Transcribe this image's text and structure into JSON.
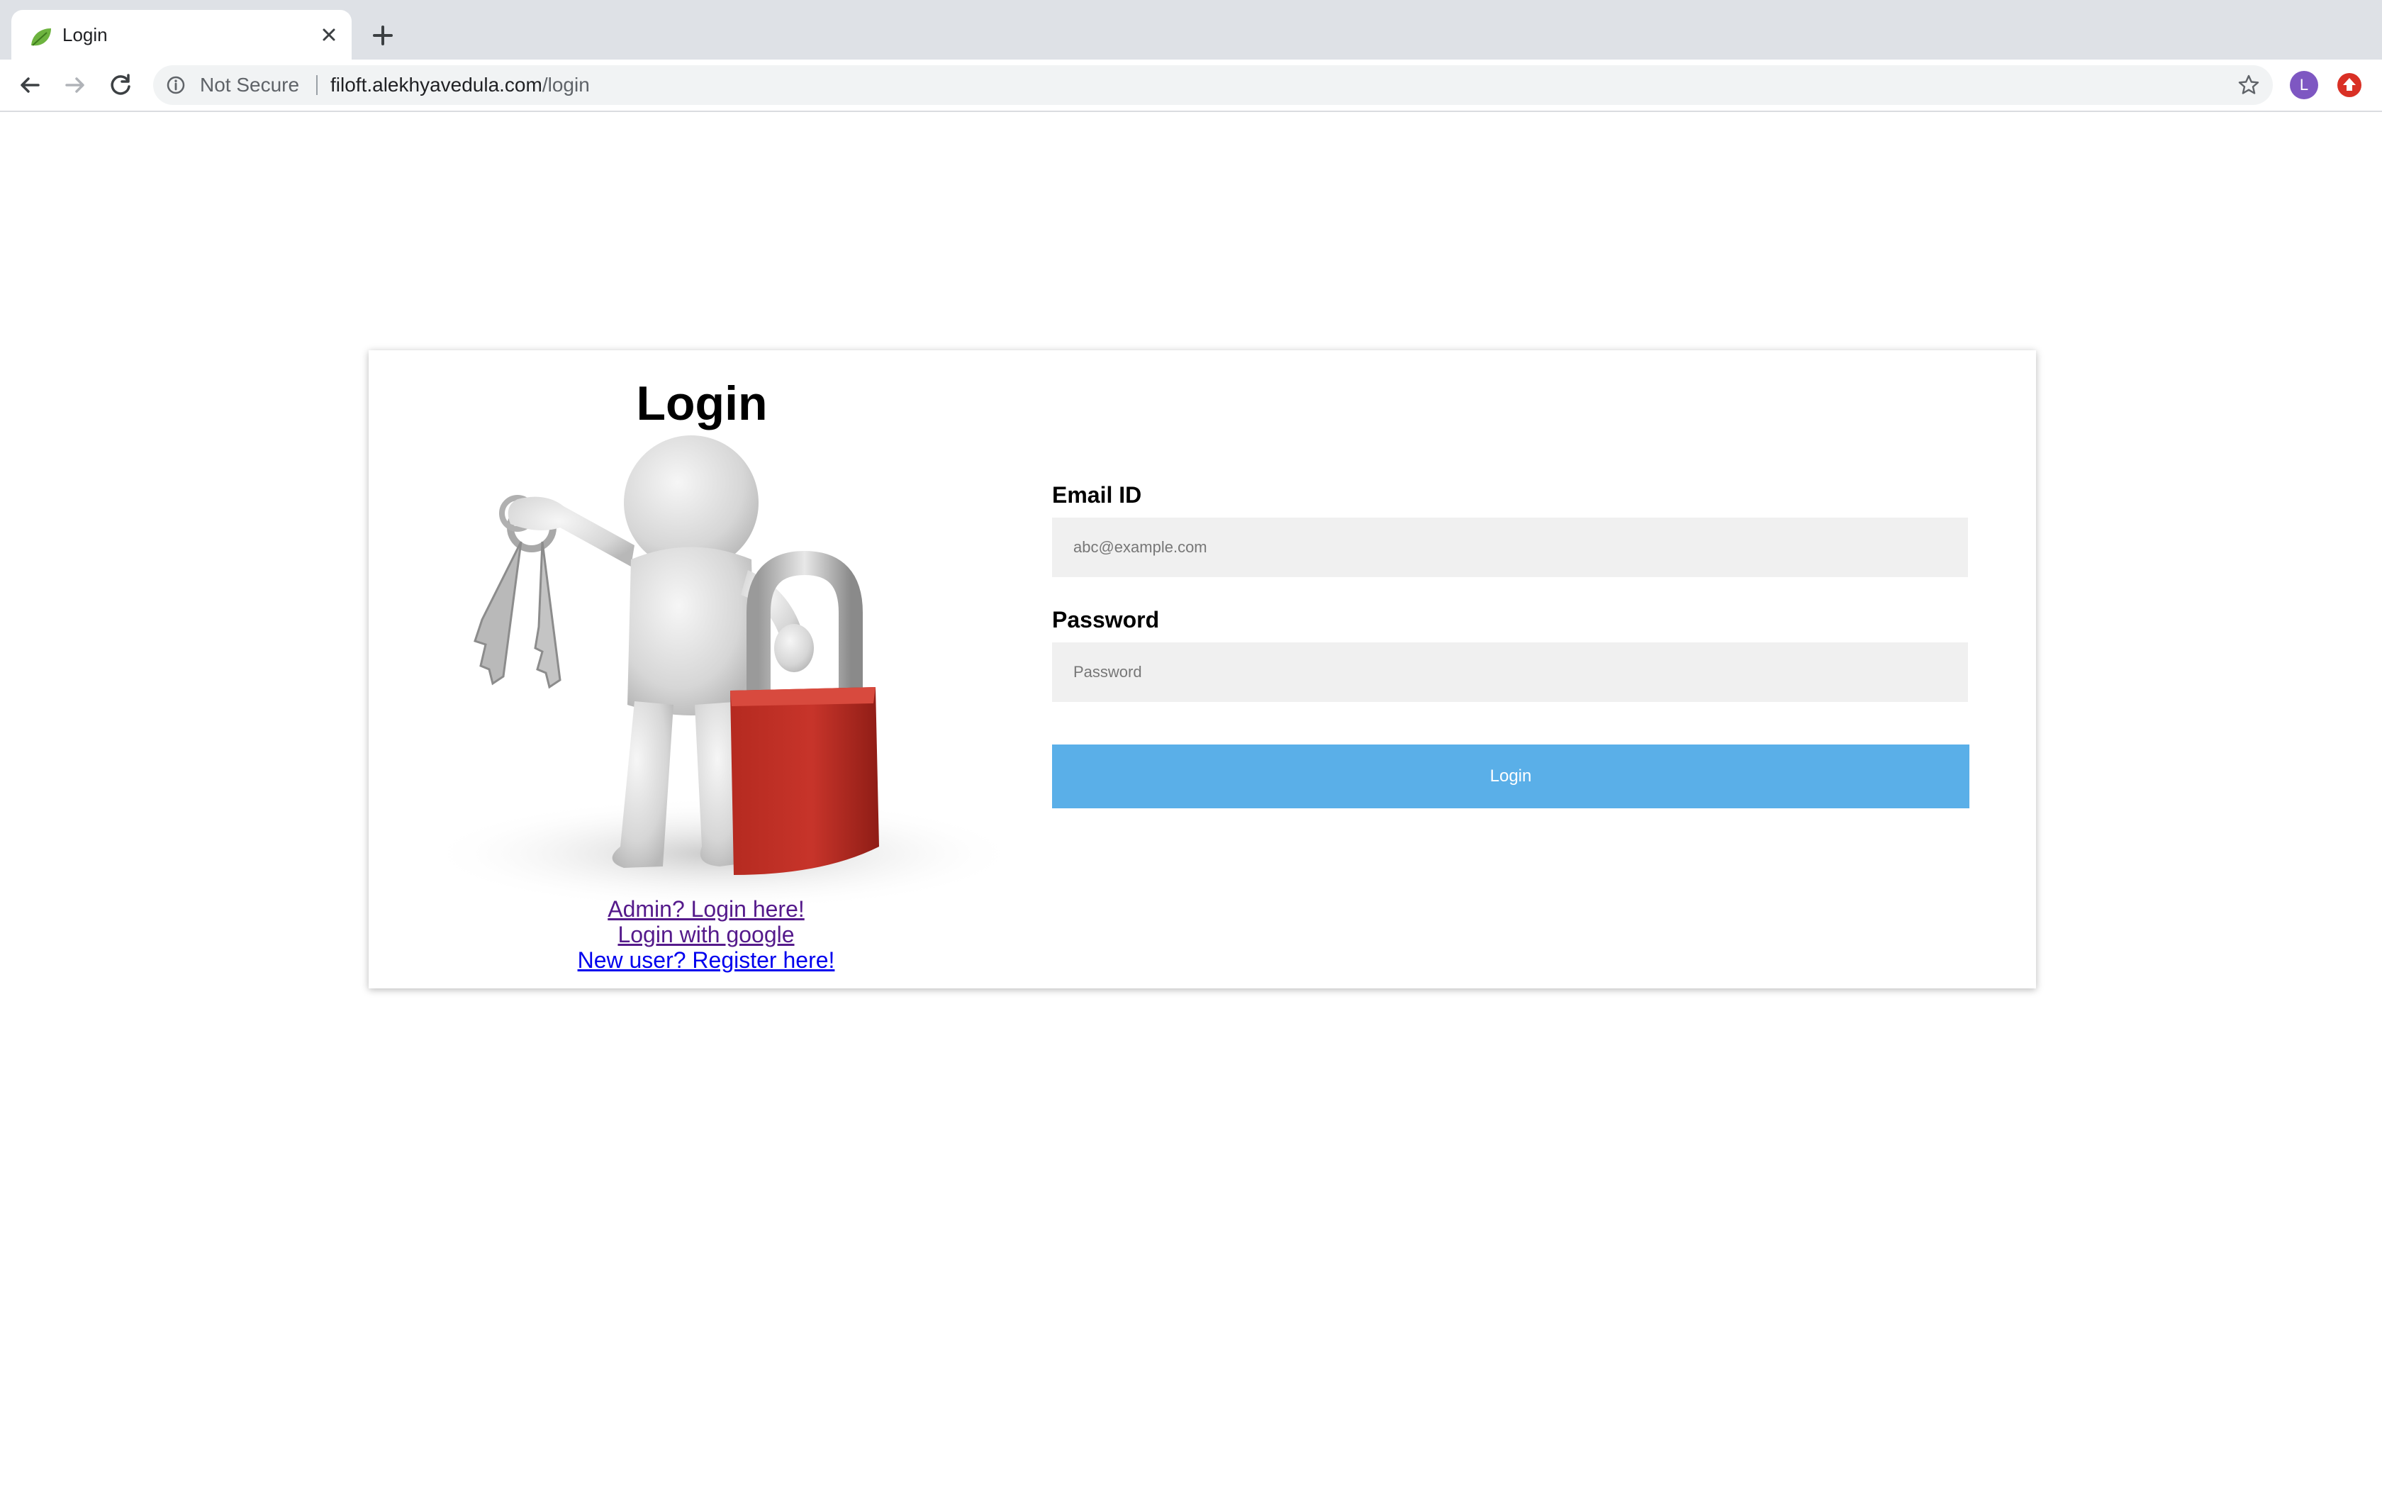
{
  "browser": {
    "tab_title": "Login",
    "security_label": "Not Secure",
    "url_host": "filoft.alekhyavedula.com",
    "url_path": "/login",
    "profile_initial": "L",
    "accent_color": "#5aafe8"
  },
  "page": {
    "title": "Login",
    "links": {
      "admin": "Admin? Login here!",
      "google": "Login with google",
      "register": "New user? Register here!"
    },
    "form": {
      "email_label": "Email ID",
      "email_placeholder": "abc@example.com",
      "email_value": "",
      "password_label": "Password",
      "password_placeholder": "Password",
      "password_value": "",
      "submit_label": "Login"
    }
  }
}
